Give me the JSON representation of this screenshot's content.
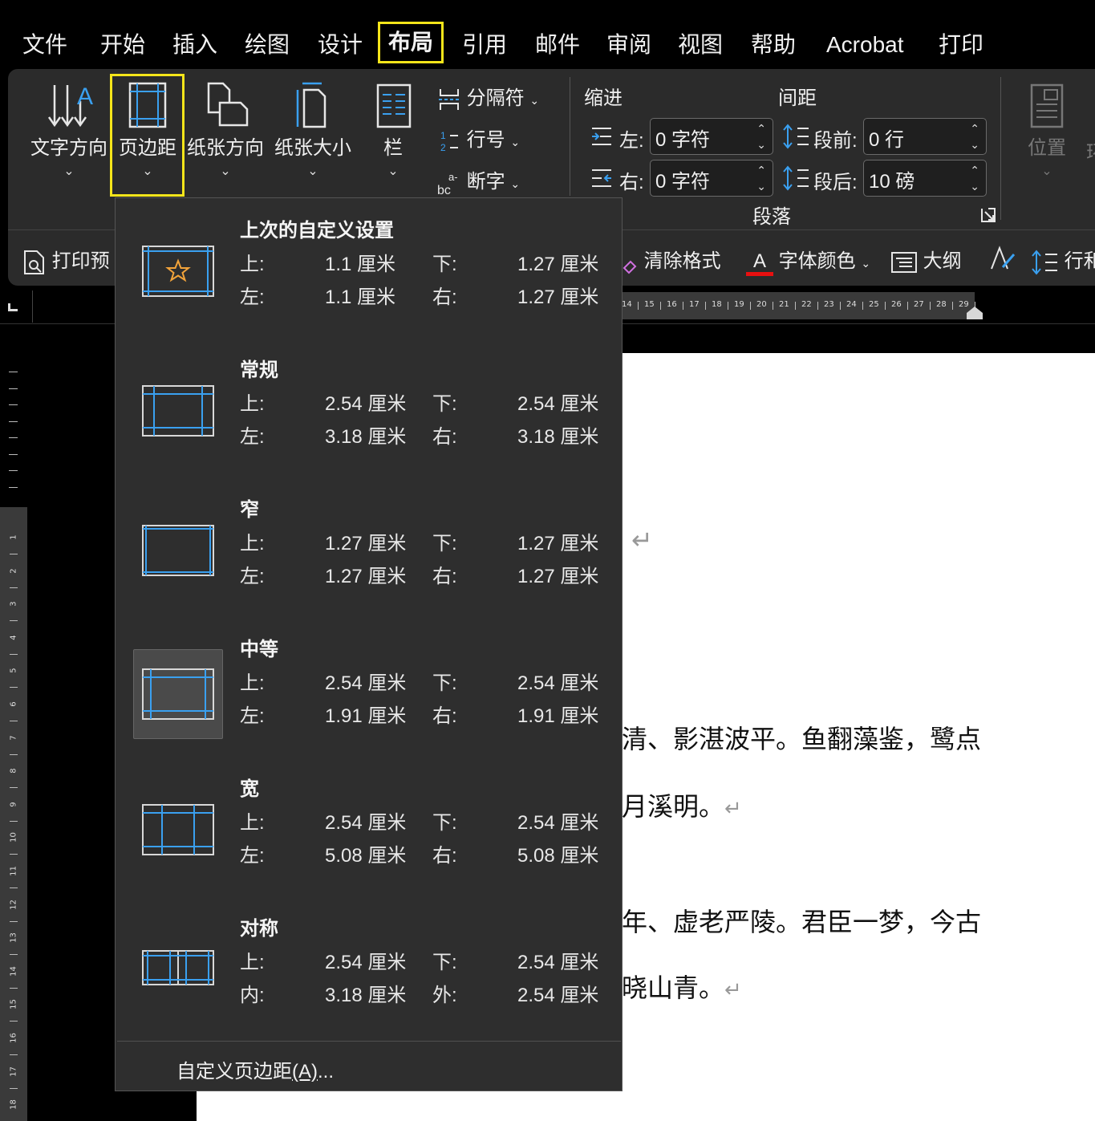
{
  "menu": {
    "items": [
      "文件",
      "开始",
      "插入",
      "绘图",
      "设计",
      "布局",
      "引用",
      "邮件",
      "审阅",
      "视图",
      "帮助",
      "Acrobat",
      "打印"
    ],
    "active": "布局"
  },
  "ribbon": {
    "text_direction": "文字方向",
    "margins": "页边距",
    "orientation": "纸张方向",
    "size": "纸张大小",
    "columns": "栏",
    "breaks": "分隔符",
    "line_numbers": "行号",
    "hyphenation": "断字",
    "indent_title": "缩进",
    "spacing_title": "间距",
    "indent_left_label": "左:",
    "indent_left_value": "0 字符",
    "indent_right_label": "右:",
    "indent_right_value": "0 字符",
    "space_before_label": "段前:",
    "space_before_value": "0 行",
    "space_after_label": "段后:",
    "space_after_value": "10 磅",
    "paragraph_group": "段落",
    "position": "位置",
    "print_preview": "打印预",
    "clear_format": "清除格式",
    "font_color": "字体颜色",
    "outline": "大纲",
    "line_spacing": "行和"
  },
  "ruler": {
    "ticks": [
      "14",
      "15",
      "16",
      "17",
      "18",
      "19",
      "20",
      "21",
      "22",
      "23",
      "24",
      "25",
      "26",
      "27",
      "28",
      "29"
    ],
    "vticks": [
      "1",
      "2",
      "3",
      "4",
      "5",
      "6",
      "7",
      "8",
      "9",
      "10",
      "11",
      "12",
      "13",
      "14",
      "15",
      "16",
      "17",
      "18"
    ]
  },
  "document": {
    "line1": "清、影湛波平。鱼翻藻鉴，鹭点",
    "line2": "月溪明。",
    "line3": "年、虚老严陵。君臣一梦，今古",
    "line4": "晓山青。",
    "return_mark": "↵"
  },
  "margins_menu": {
    "unit": "厘米",
    "presets": [
      {
        "title": "上次的自定义设置",
        "l1": "上:",
        "v1": "1.1 厘米",
        "l2": "下:",
        "v2": "1.27 厘米",
        "l3": "左:",
        "v3": "1.1 厘米",
        "l4": "右:",
        "v4": "1.27 厘米"
      },
      {
        "title": "常规",
        "l1": "上:",
        "v1": "2.54 厘米",
        "l2": "下:",
        "v2": "2.54 厘米",
        "l3": "左:",
        "v3": "3.18 厘米",
        "l4": "右:",
        "v4": "3.18 厘米"
      },
      {
        "title": "窄",
        "l1": "上:",
        "v1": "1.27 厘米",
        "l2": "下:",
        "v2": "1.27 厘米",
        "l3": "左:",
        "v3": "1.27 厘米",
        "l4": "右:",
        "v4": "1.27 厘米"
      },
      {
        "title": "中等",
        "l1": "上:",
        "v1": "2.54 厘米",
        "l2": "下:",
        "v2": "2.54 厘米",
        "l3": "左:",
        "v3": "1.91 厘米",
        "l4": "右:",
        "v4": "1.91 厘米"
      },
      {
        "title": "宽",
        "l1": "上:",
        "v1": "2.54 厘米",
        "l2": "下:",
        "v2": "2.54 厘米",
        "l3": "左:",
        "v3": "5.08 厘米",
        "l4": "右:",
        "v4": "5.08 厘米"
      },
      {
        "title": "对称",
        "l1": "上:",
        "v1": "2.54 厘米",
        "l2": "下:",
        "v2": "2.54 厘米",
        "l3": "内:",
        "v3": "3.18 厘米",
        "l4": "外:",
        "v4": "2.54 厘米"
      }
    ],
    "custom_label": "自定义页边距",
    "custom_accel": "(A)",
    "custom_suffix": "...",
    "selected_index": 3
  },
  "colors": {
    "highlight": "#f5e51a",
    "accent_blue": "#3aa0f0",
    "star": "#f2a33a",
    "font_color_bar": "#e81010"
  }
}
